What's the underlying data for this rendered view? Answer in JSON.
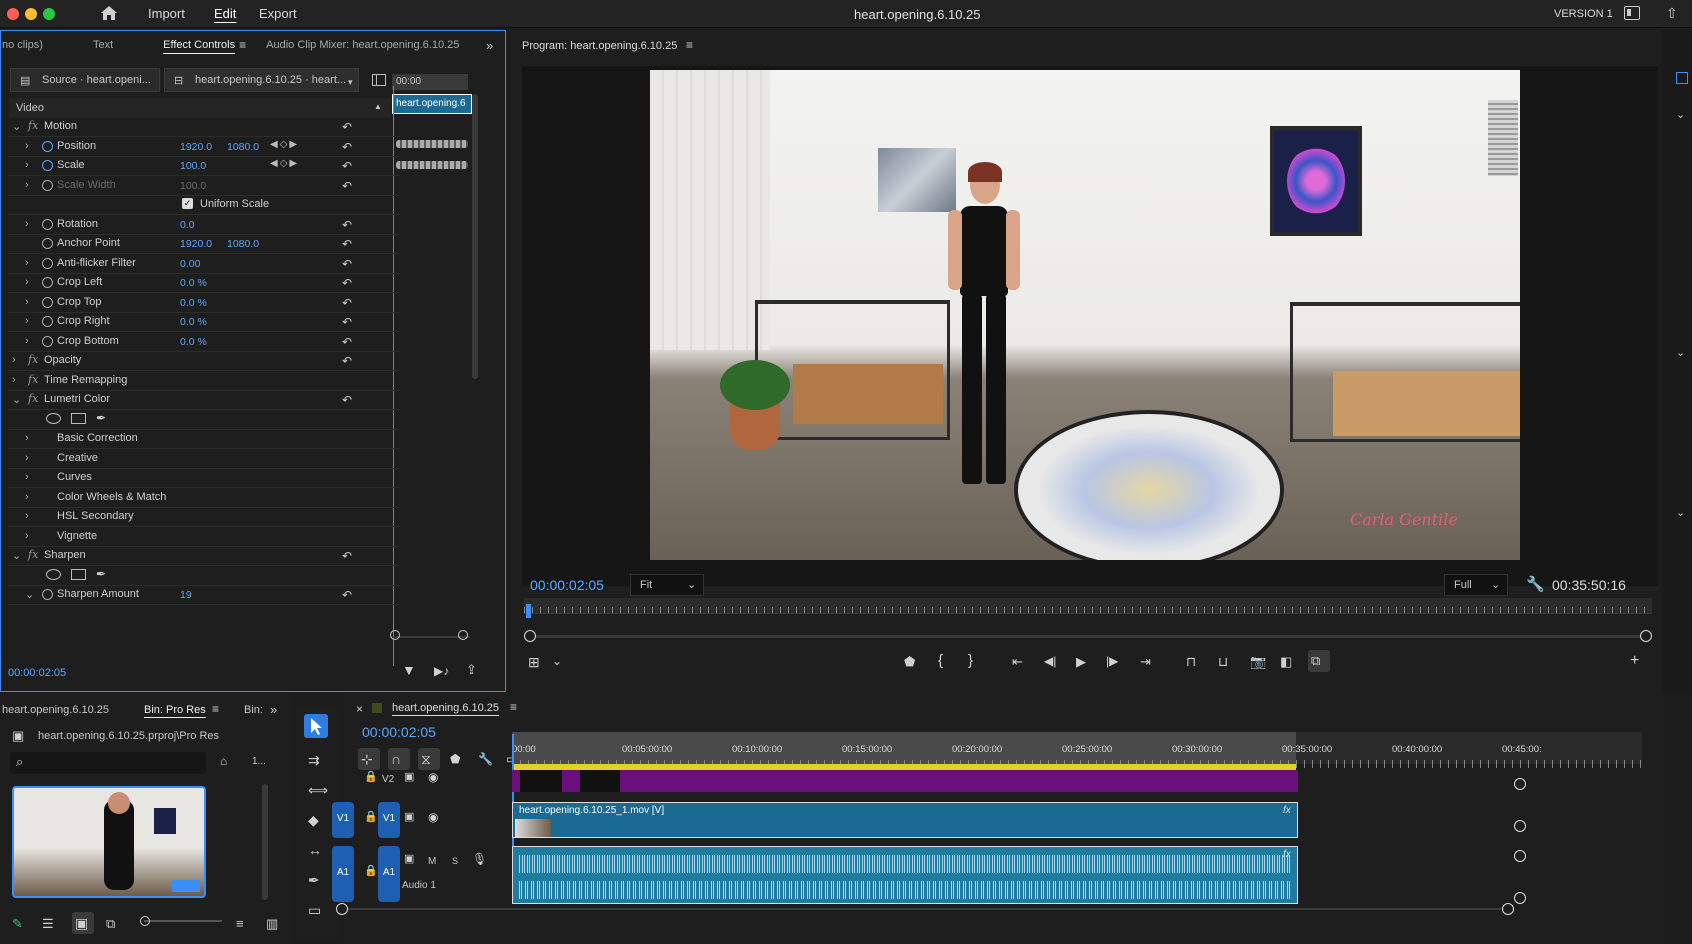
{
  "menu": {
    "home_icon": "home-icon",
    "items": [
      "Import",
      "Edit",
      "Export"
    ],
    "active": "Edit"
  },
  "title": "heart.opening.6.10.25",
  "version": "VERSION 1",
  "left_tabs": [
    "no clips)",
    "Text",
    "Effect Controls",
    "Audio Clip Mixer: heart.opening.6.10.25"
  ],
  "effect_controls": {
    "source_label": "Source · heart.openi...",
    "sequence_label": "heart.opening.6.10.25 · heart...",
    "section": "Video",
    "mini_ruler_time": "00:00",
    "mini_clip": "heart.opening.6",
    "rows": [
      {
        "name": "Motion",
        "kind": "fx"
      },
      {
        "name": "Position",
        "v1": "1920.0",
        "v2": "1080.0",
        "kind": "prop-kf"
      },
      {
        "name": "Scale",
        "v1": "100.0",
        "kind": "prop-kf"
      },
      {
        "name": "Scale Width",
        "v1": "100.0",
        "kind": "prop-dim"
      },
      {
        "name": "Uniform Scale",
        "kind": "checkbox"
      },
      {
        "name": "Rotation",
        "v1": "0.0",
        "kind": "prop"
      },
      {
        "name": "Anchor Point",
        "v1": "1920.0",
        "v2": "1080.0",
        "kind": "prop-nochev"
      },
      {
        "name": "Anti-flicker Filter",
        "v1": "0.00",
        "kind": "prop"
      },
      {
        "name": "Crop Left",
        "v1": "0.0 %",
        "kind": "prop"
      },
      {
        "name": "Crop Top",
        "v1": "0.0 %",
        "kind": "prop"
      },
      {
        "name": "Crop Right",
        "v1": "0.0 %",
        "kind": "prop"
      },
      {
        "name": "Crop Bottom",
        "v1": "0.0 %",
        "kind": "prop"
      },
      {
        "name": "Opacity",
        "kind": "fx-closed"
      },
      {
        "name": "Time Remapping",
        "kind": "fx-closed-noreset"
      },
      {
        "name": "Lumetri Color",
        "kind": "fx"
      },
      {
        "name": "",
        "kind": "masks"
      },
      {
        "name": "Basic Correction",
        "kind": "sub"
      },
      {
        "name": "Creative",
        "kind": "sub"
      },
      {
        "name": "Curves",
        "kind": "sub"
      },
      {
        "name": "Color Wheels & Match",
        "kind": "sub"
      },
      {
        "name": "HSL Secondary",
        "kind": "sub"
      },
      {
        "name": "Vignette",
        "kind": "sub"
      },
      {
        "name": "Sharpen",
        "kind": "fx"
      },
      {
        "name": "",
        "kind": "masks"
      },
      {
        "name": "Sharpen Amount",
        "v1": "19",
        "kind": "prop-open"
      }
    ],
    "timecode": "00:00:02:05"
  },
  "program": {
    "tab": "Program: heart.opening.6.10.25",
    "watermark": "Carla Gentile",
    "timecode": "00:00:02:05",
    "fit": "Fit",
    "quality": "Full",
    "duration": "00:35:50:16"
  },
  "project": {
    "tabs": [
      "heart.opening.6.10.25",
      "Bin: Pro Res",
      "Bin:"
    ],
    "path": "heart.opening.6.10.25.prproj\\Pro Res",
    "count": "1..."
  },
  "timeline": {
    "tab": "heart.opening.6.10.25",
    "timecode": "00:00:02:05",
    "ruler": [
      "00:00",
      "00:05:00:00",
      "00:10:00:00",
      "00:15:00:00",
      "00:20:00:00",
      "00:25:00:00",
      "00:30:00:00",
      "00:35:00:00",
      "00:40:00:00",
      "00:45:00:"
    ],
    "tracks": {
      "v2": "V2",
      "v1": "V1",
      "a1": "A1",
      "audio_name": "Audio 1",
      "m": "M",
      "s": "S"
    },
    "video_clip": "heart.opening.6.10.25_1.mov [V]"
  },
  "colors": {
    "accent": "#3b8ff6",
    "timecode": "#5aa8ff",
    "v2_clip": "#6b0f7a",
    "v1_clip": "#1b6a94",
    "a1_clip": "#1e7ca0"
  }
}
